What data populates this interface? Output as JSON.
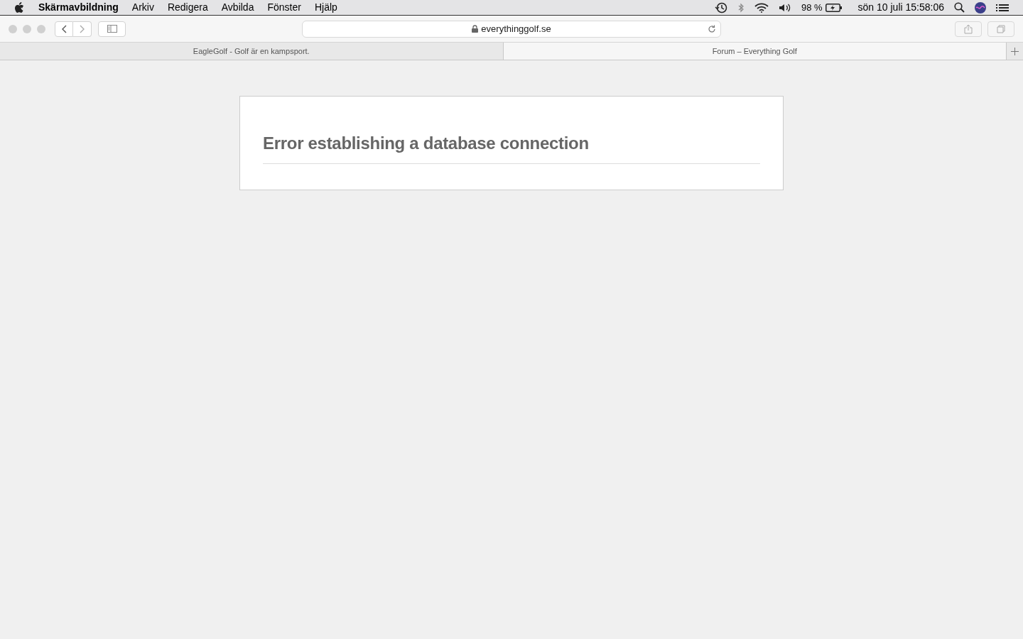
{
  "menu_bar": {
    "app_name": "Skärmavbildning",
    "menus": [
      "Arkiv",
      "Redigera",
      "Avbilda",
      "Fönster",
      "Hjälp"
    ],
    "battery": "98 %",
    "clock": "sön 10 juli 15:58:06"
  },
  "toolbar": {
    "url": "everythinggolf.se"
  },
  "tabs": [
    {
      "label": "EagleGolf - Golf är en kampsport.",
      "selected": false
    },
    {
      "label": "Forum – Everything Golf",
      "selected": true
    }
  ],
  "page": {
    "heading": "Error establishing a database connection"
  }
}
